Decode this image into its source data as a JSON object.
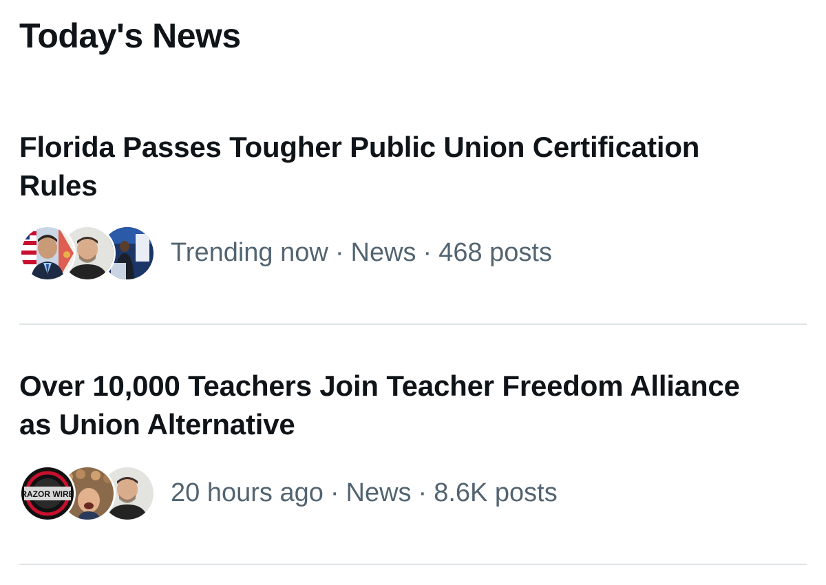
{
  "section": {
    "title": "Today's News"
  },
  "news": [
    {
      "headline": "Florida Passes Tougher Public Union Certification Rules",
      "time": "Trending now",
      "category": "News",
      "posts": "468 posts",
      "avatars": [
        "florida-official-avatar",
        "man-portrait-avatar",
        "speaker-stage-avatar"
      ]
    },
    {
      "headline": "Over 10,000 Teachers Join Teacher Freedom Alliance as Union Alternative",
      "time": "20 hours ago",
      "category": "News",
      "posts": "8.6K posts",
      "avatars": [
        "razorwire-logo-avatar",
        "crowd-smiling-avatar",
        "man-portrait-avatar"
      ],
      "logo_text": "RAZOR WIRE"
    }
  ],
  "separator": "·",
  "colors": {
    "text_primary": "#0f1419",
    "text_secondary": "#536471",
    "divider": "#dfe3e6"
  }
}
